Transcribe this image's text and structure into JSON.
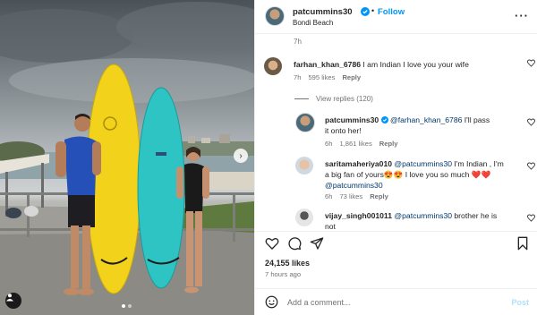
{
  "post": {
    "username": "patcummins30",
    "follow_label": "Follow",
    "location": "Bondi Beach",
    "time_top": "7h",
    "likes": "24,155 likes",
    "posted_ago": "7 hours ago"
  },
  "comments": [
    {
      "username": "farhan_khan_6786",
      "text": "I am Indian I love you your wife",
      "time": "7h",
      "likes": "595 likes",
      "reply_label": "Reply"
    },
    {
      "username": "patcummins30",
      "mention": "@farhan_khan_6786",
      "text": "I'll pass it onto her!",
      "time": "6h",
      "likes": "1,861 likes",
      "reply_label": "Reply"
    },
    {
      "username": "saritamaheriya010",
      "mention": "@patcummins30",
      "text": "I'm Indian , I'm a big fan of yours😍😍 I love you so much ❤️❤️",
      "mention2": "@patcummins30",
      "time": "6h",
      "likes": "73 likes",
      "reply_label": "Reply"
    },
    {
      "username": "vijay_singh001011",
      "mention": "@patcummins30",
      "text": "brother he is not"
    }
  ],
  "view_replies": "View replies (120)",
  "add_comment": {
    "placeholder": "Add a comment...",
    "post_label": "Post"
  },
  "icons": {
    "verified": "verified-badge-icon",
    "more": "more-options-icon",
    "like": "heart-icon",
    "comment": "comment-icon",
    "share": "paper-plane-icon",
    "save": "bookmark-icon",
    "emoji": "smiley-icon",
    "tag": "user-tag-icon",
    "next": "chevron-right-icon"
  },
  "colors": {
    "accent": "#0095f6",
    "text": "#262626",
    "muted": "#737373",
    "board_yellow": "#f2d21b",
    "board_teal": "#2ec4c4"
  }
}
